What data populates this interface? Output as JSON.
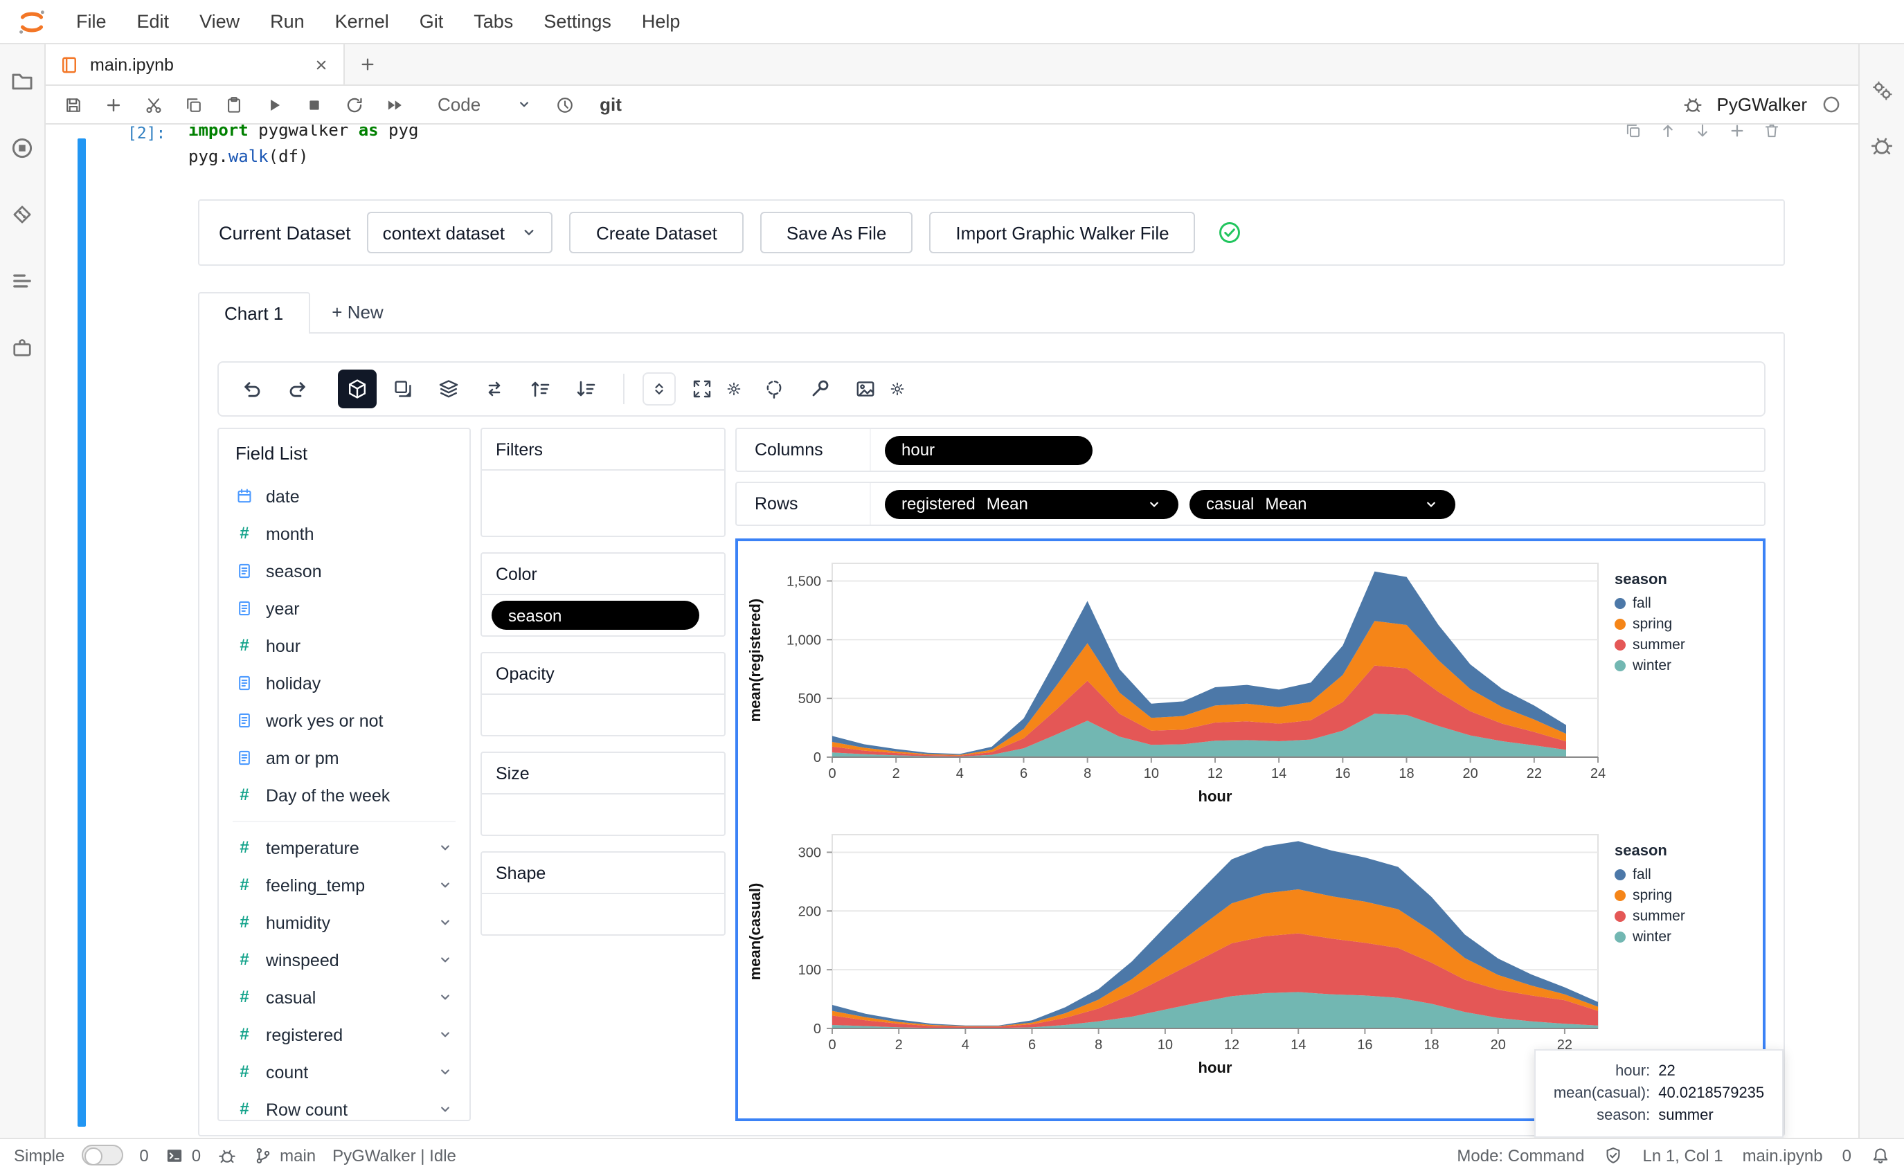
{
  "colors": {
    "jupyter_orange": "#F37626",
    "active_cell_blue": "#2196F3",
    "selection_border_blue": "#3B82F6",
    "pill_black": "#000000",
    "success_green": "#22C55E",
    "fall": "#4C78A8",
    "spring": "#F58518",
    "summer": "#E45756",
    "winter": "#72B7B2"
  },
  "icons": {
    "jupyter-logo": "orange-double-arc",
    "notebook-icon": "orange-book",
    "close-icon": "x",
    "add-icon": "plus",
    "save-icon": "floppy",
    "cut-icon": "scissors",
    "copy-icon": "overlapping-squares",
    "paste-icon": "clipboard",
    "run-icon": "play-triangle",
    "stop-icon": "filled-square",
    "restart-icon": "circular-arrow",
    "run-all-icon": "double-triangle",
    "history-icon": "clock",
    "debugger-icon": "bug",
    "kernel-status-icon": "hollow-circle",
    "file-browser-icon": "folder",
    "running-sessions-icon": "stop-circle",
    "git-icon": "diamond",
    "toc-icon": "list-lines",
    "extensions-icon": "puzzle-piece",
    "property-inspector-icon": "gears",
    "undo-icon": "arrow-curve-left",
    "redo-icon": "arrow-curve-right",
    "chart-type-icon": "cube",
    "duplicate-icon": "stacked-squares",
    "layers-icon": "stacked-layers",
    "transpose-icon": "swap-arrows",
    "sort-asc-icon": "lines-arrow-up",
    "sort-desc-icon": "lines-arrow-down",
    "size-mode-icon": "caret-up-down",
    "resize-icon": "expand-arrows",
    "config-icon": "gear",
    "selection-icon": "dashed-circle",
    "tools-icon": "wrench",
    "export-image-icon": "picture",
    "dimension-icon": "document",
    "temporal-icon": "calendar",
    "measure-icon": "hash",
    "chevron-down-icon": "caret-down",
    "success-icon": "green-check-circle",
    "git-branch-icon": "branch",
    "trust-icon": "shield-check",
    "notifications-icon": "bell",
    "terminal-icon": "dark-terminal"
  },
  "app": {
    "menubar": [
      "File",
      "Edit",
      "View",
      "Run",
      "Kernel",
      "Git",
      "Tabs",
      "Settings",
      "Help"
    ],
    "tab": {
      "title": "main.ipynb"
    },
    "toolbar": {
      "cell_type": "Code",
      "git_label": "git",
      "kernel_name": "PyGWalker"
    },
    "statusbar": {
      "simple_label": "Simple",
      "kernels_count": "0",
      "terminals_count": "0",
      "git_branch": "main",
      "app_status": "PyGWalker | Idle",
      "mode": "Mode: Command",
      "cursor_position": "Ln 1, Col 1",
      "active_file": "main.ipynb",
      "notifications_count": "0"
    }
  },
  "cell": {
    "prompt": "[2]:",
    "code_lines": [
      [
        {
          "text": "import",
          "cls": "kw"
        },
        {
          "text": " pygwalker ",
          "cls": "nm"
        },
        {
          "text": "as",
          "cls": "kw"
        },
        {
          "text": " pyg",
          "cls": "nm"
        }
      ],
      [
        {
          "text": "pyg.",
          "cls": "nm"
        },
        {
          "text": "walk",
          "cls": "fn"
        },
        {
          "text": "(df)",
          "cls": "nm"
        }
      ]
    ]
  },
  "pygwalker": {
    "dataset_bar": {
      "label": "Current Dataset",
      "selected_dataset": "context dataset",
      "create_button": "Create Dataset",
      "save_button": "Save As File",
      "import_button": "Import Graphic Walker File"
    },
    "chart_tabs": {
      "active": "Chart 1",
      "new_tab": "+ New"
    },
    "field_list": {
      "title": "Field List",
      "fields": [
        {
          "name": "date",
          "icon": "calendar",
          "kind": "dimension"
        },
        {
          "name": "month",
          "icon": "hash",
          "kind": "dimension"
        },
        {
          "name": "season",
          "icon": "doc",
          "kind": "dimension"
        },
        {
          "name": "year",
          "icon": "doc",
          "kind": "dimension"
        },
        {
          "name": "hour",
          "icon": "hash",
          "kind": "dimension"
        },
        {
          "name": "holiday",
          "icon": "doc",
          "kind": "dimension"
        },
        {
          "name": "work yes or not",
          "icon": "doc",
          "kind": "dimension"
        },
        {
          "name": "am or pm",
          "icon": "doc",
          "kind": "dimension"
        },
        {
          "name": "Day of the week",
          "icon": "hash",
          "kind": "dimension"
        },
        {
          "name": "temperature",
          "icon": "hash",
          "kind": "measure"
        },
        {
          "name": "feeling_temp",
          "icon": "hash",
          "kind": "measure"
        },
        {
          "name": "humidity",
          "icon": "hash",
          "kind": "measure"
        },
        {
          "name": "winspeed",
          "icon": "hash",
          "kind": "measure"
        },
        {
          "name": "casual",
          "icon": "hash",
          "kind": "measure"
        },
        {
          "name": "registered",
          "icon": "hash",
          "kind": "measure"
        },
        {
          "name": "count",
          "icon": "hash",
          "kind": "measure"
        },
        {
          "name": "Row count",
          "icon": "hash",
          "kind": "measure"
        }
      ]
    },
    "encodings": {
      "filters_label": "Filters",
      "color_label": "Color",
      "color_pill": "season",
      "opacity_label": "Opacity",
      "size_label": "Size",
      "shape_label": "Shape",
      "columns_label": "Columns",
      "columns_pills": [
        "hour"
      ],
      "rows_label": "Rows",
      "rows_pills": [
        {
          "field": "registered",
          "agg": "Mean"
        },
        {
          "field": "casual",
          "agg": "Mean"
        }
      ]
    },
    "tooltip": {
      "rows": [
        {
          "label": "hour:",
          "value": "22"
        },
        {
          "label": "mean(casual):",
          "value": "40.0218579235"
        },
        {
          "label": "season:",
          "value": "summer"
        }
      ]
    }
  },
  "chart_data": [
    {
      "type": "area",
      "stacked": true,
      "title": "",
      "xlabel": "hour",
      "ylabel": "mean(registered)",
      "x": [
        0,
        1,
        2,
        3,
        4,
        5,
        6,
        7,
        8,
        9,
        10,
        11,
        12,
        13,
        14,
        15,
        16,
        17,
        18,
        19,
        20,
        21,
        22,
        23
      ],
      "xlim": [
        0,
        24
      ],
      "ylim": [
        0,
        1650
      ],
      "xticks": [
        0,
        2,
        4,
        6,
        8,
        10,
        12,
        14,
        16,
        18,
        20,
        22,
        24
      ],
      "yticks": [
        0,
        500,
        1000,
        1500
      ],
      "ytick_labels": [
        "0",
        "500",
        "1,000",
        "1,500"
      ],
      "grid": true,
      "legend_title": "season",
      "legend_position": "right",
      "stack_order": [
        "winter",
        "summer",
        "spring",
        "fall"
      ],
      "series": [
        {
          "name": "fall",
          "color": "#4C78A8",
          "values": [
            50,
            30,
            20,
            10,
            8,
            25,
            90,
            220,
            360,
            200,
            120,
            125,
            155,
            160,
            150,
            165,
            250,
            420,
            410,
            300,
            210,
            155,
            120,
            75
          ]
        },
        {
          "name": "spring",
          "color": "#F58518",
          "values": [
            40,
            25,
            15,
            8,
            6,
            20,
            80,
            200,
            320,
            180,
            110,
            115,
            145,
            150,
            140,
            155,
            230,
            380,
            370,
            270,
            190,
            140,
            105,
            65
          ]
        },
        {
          "name": "summer",
          "color": "#E45756",
          "values": [
            50,
            30,
            20,
            10,
            7,
            23,
            85,
            210,
            340,
            195,
            120,
            125,
            155,
            160,
            150,
            165,
            245,
            410,
            395,
            290,
            205,
            150,
            115,
            72
          ]
        },
        {
          "name": "winter",
          "color": "#72B7B2",
          "values": [
            40,
            25,
            15,
            8,
            6,
            20,
            75,
            190,
            310,
            175,
            105,
            110,
            140,
            145,
            135,
            150,
            225,
            370,
            360,
            265,
            185,
            135,
            100,
            62
          ]
        }
      ]
    },
    {
      "type": "area",
      "stacked": true,
      "title": "",
      "xlabel": "hour",
      "ylabel": "mean(casual)",
      "x": [
        0,
        1,
        2,
        3,
        4,
        5,
        6,
        7,
        8,
        9,
        10,
        11,
        12,
        13,
        14,
        15,
        16,
        17,
        18,
        19,
        20,
        21,
        22,
        23
      ],
      "xlim": [
        0,
        23
      ],
      "ylim": [
        0,
        330
      ],
      "xticks": [
        0,
        2,
        4,
        6,
        8,
        10,
        12,
        14,
        16,
        18,
        20,
        22
      ],
      "yticks": [
        0,
        100,
        200,
        300
      ],
      "ytick_labels": [
        "0",
        "100",
        "200",
        "300"
      ],
      "grid": true,
      "legend_title": "season",
      "legend_position": "right",
      "stack_order": [
        "winter",
        "summer",
        "spring",
        "fall"
      ],
      "series": [
        {
          "name": "fall",
          "color": "#4C78A8",
          "values": [
            10,
            6,
            4,
            2,
            1,
            1,
            4,
            10,
            18,
            30,
            46,
            60,
            75,
            80,
            82,
            78,
            75,
            72,
            58,
            40,
            28,
            19,
            12,
            8
          ]
        },
        {
          "name": "spring",
          "color": "#F58518",
          "values": [
            8,
            5,
            3,
            2,
            1,
            1,
            3,
            8,
            15,
            26,
            40,
            55,
            68,
            73,
            75,
            72,
            70,
            66,
            54,
            37,
            25,
            17,
            10,
            7
          ]
        },
        {
          "name": "summer",
          "color": "#E45756",
          "values": [
            16,
            10,
            6,
            3,
            2,
            2,
            5,
            12,
            22,
            38,
            55,
            72,
            90,
            97,
            100,
            95,
            90,
            85,
            70,
            55,
            48,
            44,
            40.02,
            25
          ]
        },
        {
          "name": "winter",
          "color": "#72B7B2",
          "values": [
            6,
            4,
            2,
            1,
            1,
            1,
            2,
            6,
            12,
            20,
            32,
            44,
            55,
            60,
            62,
            58,
            56,
            52,
            42,
            28,
            18,
            12,
            8,
            5
          ]
        }
      ]
    }
  ]
}
